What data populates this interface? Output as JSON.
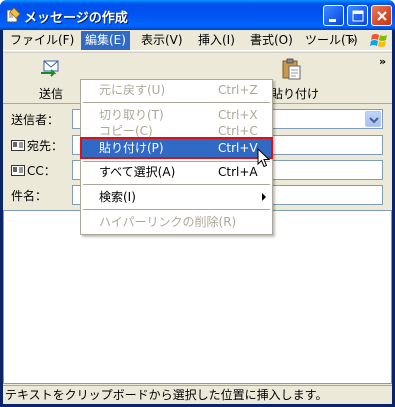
{
  "window": {
    "title": "メッセージの作成"
  },
  "menubar": {
    "items": [
      {
        "label": "ファイル(F)"
      },
      {
        "label": "編集(E)"
      },
      {
        "label": "表示(V)"
      },
      {
        "label": "挿入(I)"
      },
      {
        "label": "書式(O)"
      },
      {
        "label": "ツール(T)"
      }
    ],
    "overflow": "»"
  },
  "toolbar": {
    "send_label": "送信",
    "paste_label": "貼り付け",
    "overflow": "»"
  },
  "fields": {
    "from_label": "送信者：",
    "to_label": "宛先：",
    "cc_label": "CC：",
    "subject_label": "件名："
  },
  "edit_menu": {
    "undo": {
      "label": "元に戻す(U)",
      "shortcut": "Ctrl+Z"
    },
    "cut": {
      "label": "切り取り(T)",
      "shortcut": "Ctrl+X"
    },
    "copy": {
      "label": "コピー(C)",
      "shortcut": "Ctrl+C"
    },
    "paste": {
      "label": "貼り付け(P)",
      "shortcut": "Ctrl+V"
    },
    "select_all": {
      "label": "すべて選択(A)",
      "shortcut": "Ctrl+A"
    },
    "find": {
      "label": "検索(I)"
    },
    "remove_hyperlink": {
      "label": "ハイパーリンクの削除(R)"
    }
  },
  "statusbar": {
    "text": "テキストをクリップボードから選択した位置に挿入します。"
  },
  "colors": {
    "titlebar": "#0053ee",
    "highlight": "#316ac5",
    "outline": "#e01010",
    "face": "#ece9d8"
  }
}
